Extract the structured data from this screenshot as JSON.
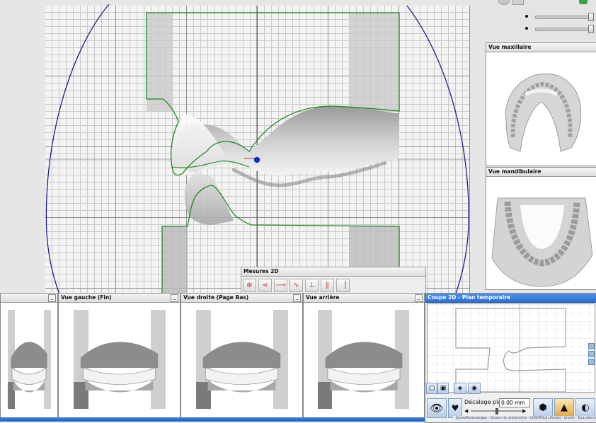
{
  "main_view": {
    "grid": "visible"
  },
  "top_sliders": [
    {
      "value_fraction": 0.98
    },
    {
      "value_fraction": 0.98
    }
  ],
  "panels": {
    "maxillary": {
      "title": "Vue maxillaire"
    },
    "mandibular": {
      "title": "Vue mandibulaire"
    }
  },
  "measures": {
    "title": "Mesures 2D",
    "tools": [
      "point-to-point-icon",
      "angle-icon",
      "point-to-line-icon",
      "curve-length-icon",
      "perpendicular-icon",
      "midline-icon",
      "split-icon"
    ]
  },
  "bottom_views": [
    {
      "title": ""
    },
    {
      "title": "Vue gauche (Fin)"
    },
    {
      "title": "Vue droite (Page Bas)"
    },
    {
      "title": "Vue arrière"
    }
  ],
  "section_panel": {
    "title": "Coupe 2D - Plan temporaire",
    "offset_label": "Décalage plan:",
    "offset_value": "0.00 mm",
    "colors": {
      "title_bar": "#2a6fd6",
      "accent": "#1f6fd2"
    }
  },
  "status_bar": {
    "text": "Zoom/Panoramique : Glisser-clic droit/centre · CONTRÔLE=Pivoter · Entrée · Tout sélectionner"
  },
  "colors": {
    "outline": "#1c8a1c",
    "arc": "#1e1e8c",
    "point": "#1030c8",
    "crosshair": "#333333"
  }
}
